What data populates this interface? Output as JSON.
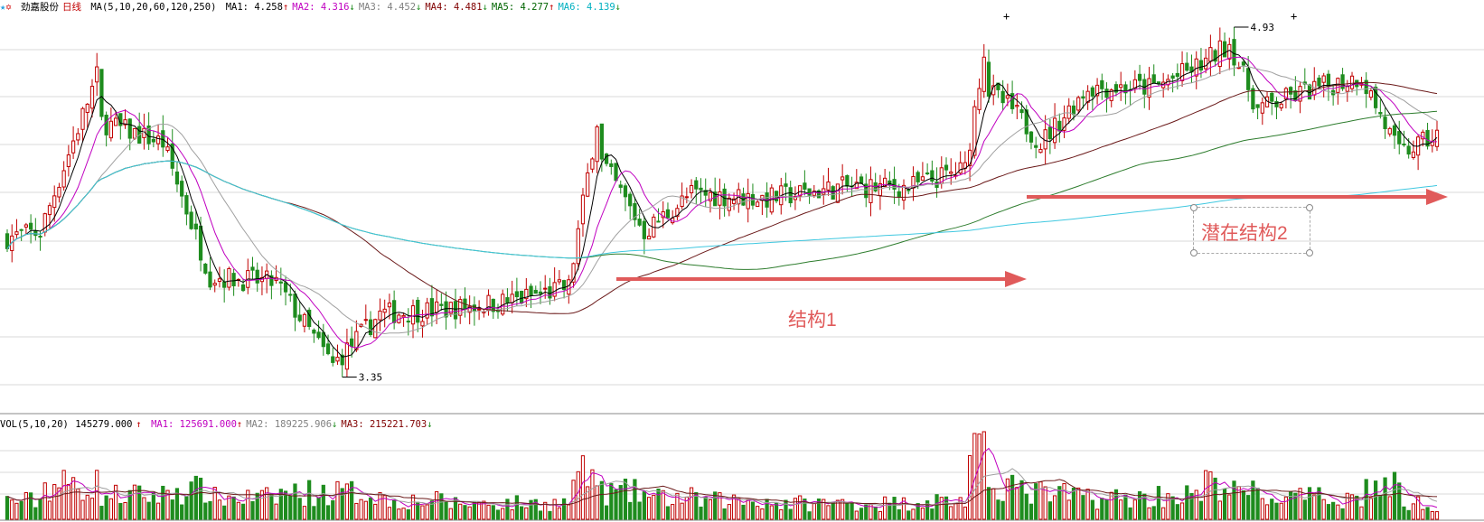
{
  "header": {
    "stock_name": "劲嘉股份",
    "period": "日线",
    "ma_title": "MA(5,10,20,60,120,250)",
    "mas": [
      {
        "label": "MA1: 4.258",
        "arrow": "↑",
        "color": "#000000"
      },
      {
        "label": "MA2: 4.316",
        "arrow": "↓",
        "color": "#c000c0"
      },
      {
        "label": "MA3: 4.452",
        "arrow": "↓",
        "color": "#808080"
      },
      {
        "label": "MA4: 4.481",
        "arrow": "↓",
        "color": "#800000"
      },
      {
        "label": "MA5: 4.277",
        "arrow": "↑",
        "color": "#006400"
      },
      {
        "label": "MA6: 4.139",
        "arrow": "↓",
        "color": "#00b0c0"
      }
    ]
  },
  "price_chart": {
    "high_label": "4.93",
    "low_label": "3.35",
    "y_range": [
      3.28,
      5.02
    ],
    "colors": {
      "up": "#c00000",
      "down": "#1e8c1e",
      "grid": "#d9d9d9"
    }
  },
  "annotations": {
    "structure1": "结构1",
    "structure2": "潜在结构2",
    "arrow_color": "#e05a5a"
  },
  "volume": {
    "title": "VOL(5,10,20)",
    "value": "145279.000",
    "value_arrow": "↑",
    "mas": [
      {
        "label": "MA1: 125691.000",
        "arrow": "↑",
        "color": "#c000c0"
      },
      {
        "label": "MA2: 189225.906",
        "arrow": "↓",
        "color": "#808080"
      },
      {
        "label": "MA3: 215221.703",
        "arrow": "↓",
        "color": "#800000"
      }
    ]
  },
  "chart_data": {
    "type": "candlestick",
    "series_note": "",
    "segments": [
      {
        "len": 8,
        "start": 4.02,
        "end": 4.05,
        "vol": 0.7
      },
      {
        "len": 12,
        "start": 4.05,
        "end": 4.75,
        "vol": 1.3
      },
      {
        "len": 14,
        "start": 4.55,
        "end": 4.45,
        "vol": 0.9
      },
      {
        "len": 10,
        "start": 4.45,
        "end": 3.85,
        "vol": 1.1
      },
      {
        "len": 14,
        "start": 3.85,
        "end": 3.82,
        "vol": 0.8
      },
      {
        "len": 12,
        "start": 3.82,
        "end": 3.45,
        "vol": 1.0
      },
      {
        "len": 10,
        "start": 3.45,
        "end": 3.68,
        "vol": 1.0
      },
      {
        "len": 14,
        "start": 3.68,
        "end": 3.7,
        "vol": 0.7
      },
      {
        "len": 14,
        "start": 3.7,
        "end": 3.74,
        "vol": 0.6
      },
      {
        "len": 12,
        "start": 3.74,
        "end": 3.8,
        "vol": 0.6
      },
      {
        "len": 6,
        "start": 3.8,
        "end": 4.55,
        "vol": 1.6
      },
      {
        "len": 10,
        "start": 4.4,
        "end": 4.05,
        "vol": 1.0
      },
      {
        "len": 10,
        "start": 4.05,
        "end": 4.22,
        "vol": 0.8
      },
      {
        "len": 16,
        "start": 4.22,
        "end": 4.2,
        "vol": 0.7
      },
      {
        "len": 16,
        "start": 4.2,
        "end": 4.25,
        "vol": 0.6
      },
      {
        "len": 14,
        "start": 4.25,
        "end": 4.25,
        "vol": 0.6
      },
      {
        "len": 12,
        "start": 4.25,
        "end": 4.33,
        "vol": 0.7
      },
      {
        "len": 4,
        "start": 4.33,
        "end": 4.87,
        "vol": 2.2
      },
      {
        "len": 6,
        "start": 4.7,
        "end": 4.6,
        "vol": 1.4
      },
      {
        "len": 6,
        "start": 4.6,
        "end": 4.45,
        "vol": 1.0
      },
      {
        "len": 10,
        "start": 4.45,
        "end": 4.7,
        "vol": 0.9
      },
      {
        "len": 14,
        "start": 4.7,
        "end": 4.7,
        "vol": 0.8
      },
      {
        "len": 10,
        "start": 4.7,
        "end": 4.8,
        "vol": 0.9
      },
      {
        "len": 6,
        "start": 4.8,
        "end": 4.9,
        "vol": 1.3
      },
      {
        "len": 6,
        "start": 4.9,
        "end": 4.6,
        "vol": 1.0
      },
      {
        "len": 10,
        "start": 4.6,
        "end": 4.68,
        "vol": 0.8
      },
      {
        "len": 12,
        "start": 4.68,
        "end": 4.75,
        "vol": 0.8
      },
      {
        "len": 8,
        "start": 4.75,
        "end": 4.4,
        "vol": 1.2
      },
      {
        "len": 8,
        "start": 4.4,
        "end": 4.48,
        "vol": 0.6
      }
    ]
  }
}
